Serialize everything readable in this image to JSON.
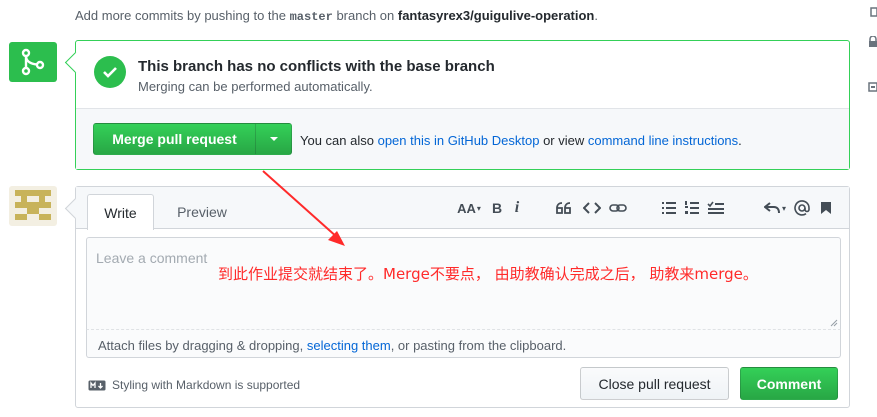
{
  "top_note": {
    "prefix": "Add more commits by pushing to the ",
    "branch": "master",
    "middle": " branch on ",
    "repo": "fantasyrex3/guigulive-operation",
    "suffix": "."
  },
  "merge": {
    "title": "This branch has no conflicts with the base branch",
    "subtitle": "Merging can be performed automatically.",
    "merge_button": "Merge pull request",
    "hint_prefix": "You can also ",
    "hint_link1": "open this in GitHub Desktop",
    "hint_middle": " or view ",
    "hint_link2": "command line instructions",
    "hint_suffix": "."
  },
  "comment": {
    "tab_write": "Write",
    "tab_preview": "Preview",
    "toolbar": {
      "header": "AA",
      "bold": "B",
      "italic": "i"
    },
    "placeholder": "Leave a comment",
    "attach_prefix": "Attach files by dragging & dropping, ",
    "attach_link": "selecting them",
    "attach_suffix": ", or pasting from the clipboard.",
    "markdown_note": "Styling with Markdown is supported",
    "close_button": "Close pull request",
    "comment_button": "Comment"
  },
  "annotation": {
    "text": "到此作业提交就结束了。Merge不要点， 由助教确认完成之后， 助教来merge。",
    "color": "#ff2a2a"
  },
  "colors": {
    "green": "#2cbe4e",
    "link": "#0366d6"
  }
}
